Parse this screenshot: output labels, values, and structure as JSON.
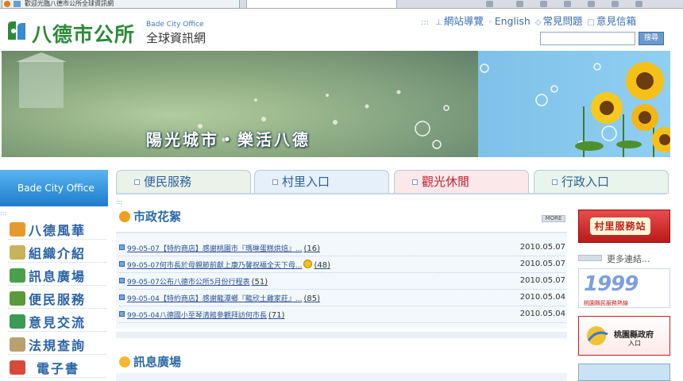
{
  "browser": {
    "tab_title": "歡迎光臨八德市公所全球資訊網"
  },
  "header": {
    "logo_cn": "八德市公所",
    "logo_en": "Bade City Office",
    "logo_sub": "全球資訊網",
    "links": [
      "網站導覽",
      "English",
      "常見問題",
      "意見信箱"
    ],
    "search_button": "搜尋"
  },
  "banner": {
    "slogan": "陽光城市・樂活八德"
  },
  "sidebar": {
    "header": "Bade City Office",
    "items": [
      {
        "label": "八德風華",
        "color": "#e79a2b"
      },
      {
        "label": "組織介紹",
        "color": "#c7b45a"
      },
      {
        "label": "訊息廣場",
        "color": "#4aa04a"
      },
      {
        "label": "便民服務",
        "color": "#5a9a3a"
      },
      {
        "label": "意見交流",
        "color": "#3c9a56"
      },
      {
        "label": "法規查詢",
        "color": "#b8a070"
      },
      {
        "label": "電子書",
        "color": "#d84a3a"
      }
    ]
  },
  "tabs": [
    {
      "label": "便民服務",
      "bg": "#eaf2ea",
      "color": "#2c5f9c"
    },
    {
      "label": "村里入口",
      "bg": "#e6f0fa",
      "color": "#2c5f9c"
    },
    {
      "label": "觀光休閒",
      "bg": "#fbe8ea",
      "color": "#c02030"
    },
    {
      "label": "行政入口",
      "bg": "#e8f4ec",
      "color": "#2c5f9c"
    }
  ],
  "news_section": {
    "title": "市政花絮",
    "more": "MORE",
    "items": [
      {
        "title": "99-05-07【特約商店】感謝桃園市『瑪琳蛋糕烘焙』...",
        "count": "(16)",
        "date": "2010.05.07",
        "smiley": false
      },
      {
        "title": "99-05-07何市長於母親節前獻上康乃馨祝福全天下母...",
        "count": "(48)",
        "date": "2010.05.07",
        "smiley": true
      },
      {
        "title": "99-05-07公布八德市公所5月份行程表",
        "count": "(51)",
        "date": "2010.05.07",
        "smiley": false
      },
      {
        "title": "99-05-04【特約商店】感謝龍潭鄉『龍欣土雞家莊』...",
        "count": "(85)",
        "date": "2010.05.04",
        "smiley": false
      },
      {
        "title": "99-05-04八德國小至琴清館參觀拜訪何市長",
        "count": "(71)",
        "date": "2010.05.04",
        "smiley": false
      }
    ]
  },
  "message_section": {
    "title": "訊息廣場"
  },
  "right": {
    "village_banner": "村里服務站",
    "more_links": "更多連結...",
    "banner_1999": "1999",
    "banner_1999_sub": "桃園縣民服務熱線",
    "county_title": "桃園縣政府",
    "county_sub": "入口"
  }
}
